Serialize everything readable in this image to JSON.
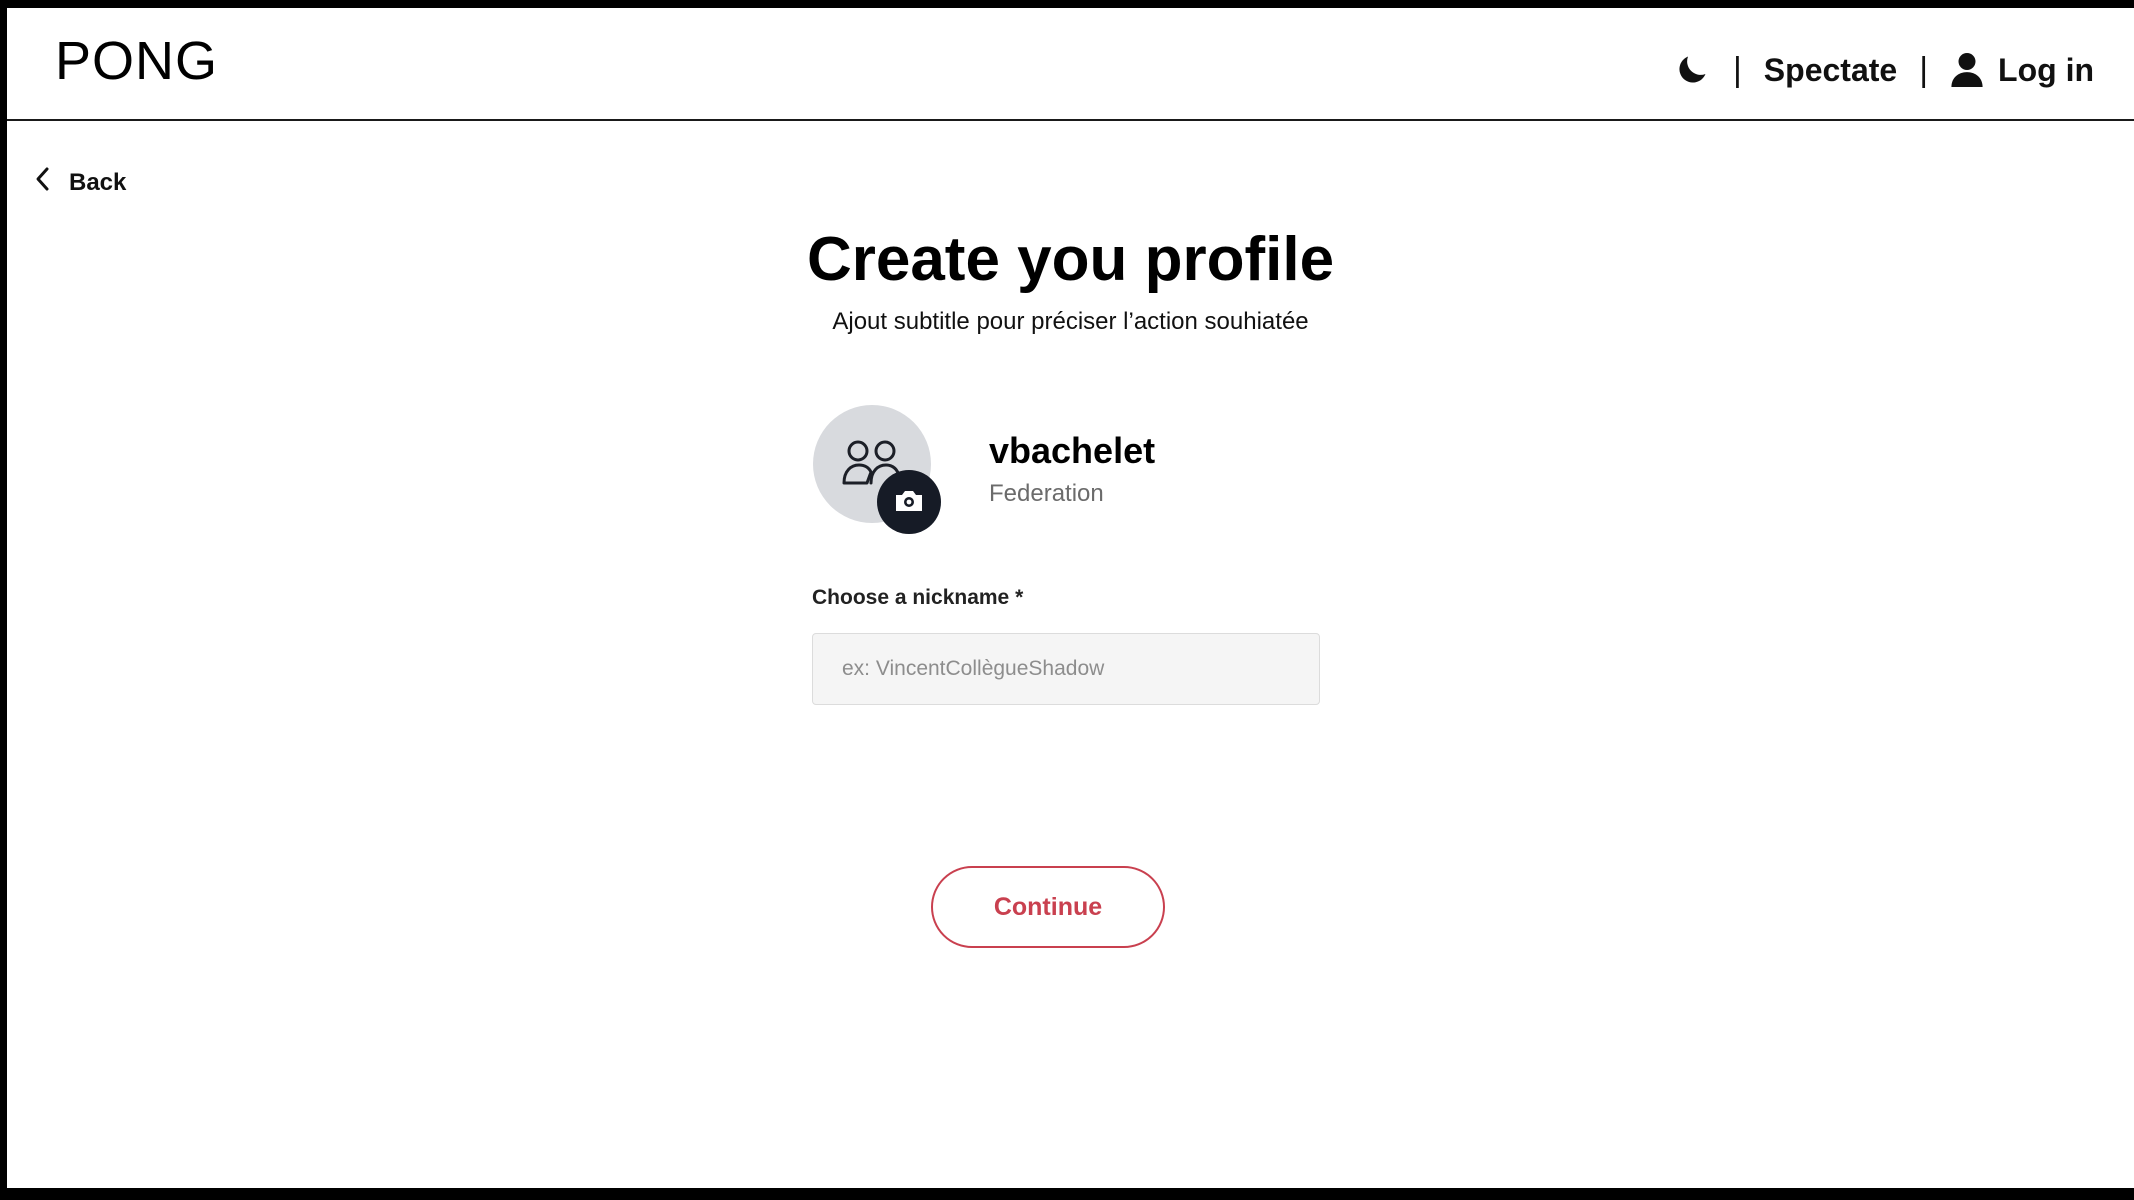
{
  "header": {
    "logo": "PONG",
    "theme_icon": "moon-icon",
    "separator": "|",
    "spectate_label": "Spectate",
    "login_icon": "user-icon",
    "login_label": "Log in"
  },
  "back": {
    "icon": "chevron-left-icon",
    "label": "Back"
  },
  "page": {
    "title": "Create you profile",
    "subtitle": "Ajout subtitle pour préciser l’action souhiatée"
  },
  "profile": {
    "avatar_icon": "users-icon",
    "camera_icon": "camera-icon",
    "username": "vbachelet",
    "campus": "Federation"
  },
  "form": {
    "nickname_label": "Choose a nickname *",
    "nickname_placeholder": "ex: VincentCollègueShadow",
    "nickname_value": ""
  },
  "actions": {
    "continue_label": "Continue"
  },
  "colors": {
    "accent": "#c9404f",
    "dark": "#161b26",
    "avatar_bg": "#d8dade",
    "input_bg": "#f5f5f5"
  }
}
